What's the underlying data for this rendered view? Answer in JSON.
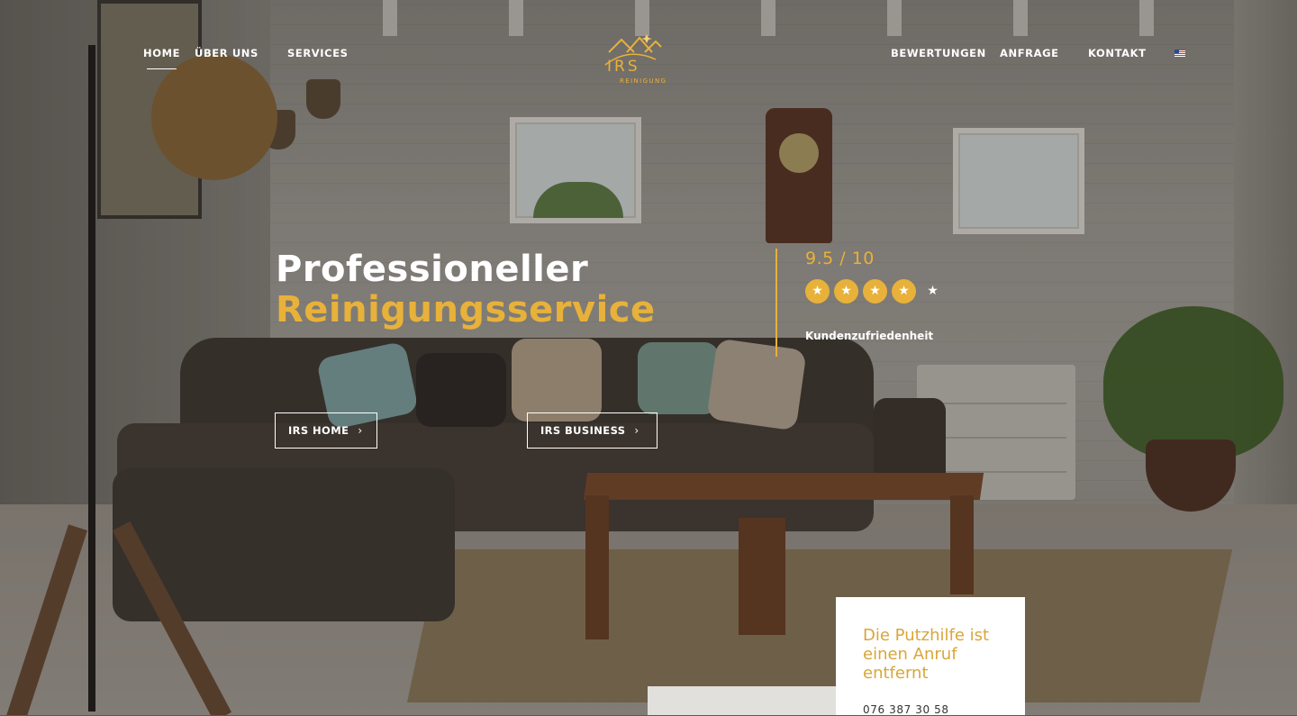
{
  "nav": {
    "items": [
      {
        "label": "HOME",
        "active": true
      },
      {
        "label": "ÜBER UNS"
      },
      {
        "label": "SERVICES"
      },
      {
        "label": "BEWERTUNGEN"
      },
      {
        "label": "ANFRAGE"
      },
      {
        "label": "KONTAKT"
      }
    ],
    "language_icon": "us-flag-icon"
  },
  "logo": {
    "text": "IRS",
    "subtext": "REINIGUNG",
    "icon": "house-roofs-icon",
    "color": "#e8b13a"
  },
  "hero": {
    "title_line1": "Professioneller",
    "title_line2": "Reinigungsservice",
    "accent_color": "#e8b13a",
    "buttons": [
      {
        "label": "IRS HOME",
        "icon": "chevron-right-icon"
      },
      {
        "label": "IRS BUSINESS",
        "icon": "chevron-right-icon"
      }
    ]
  },
  "rating": {
    "score": "9.5 / 10",
    "stars_filled": 4,
    "stars_total": 5,
    "caption": "Kundenzufriedenheit"
  },
  "contact_card": {
    "title": "Die Putzhilfe ist einen Anruf entfernt",
    "phone": "076 387 30 58"
  }
}
